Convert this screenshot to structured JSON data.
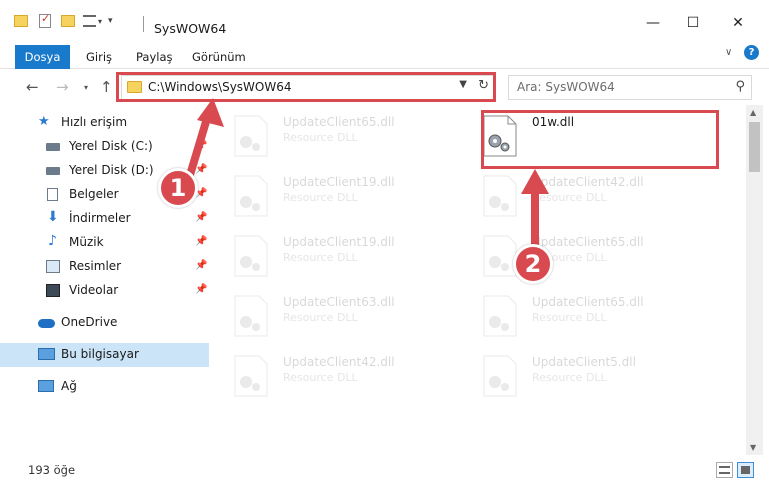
{
  "window": {
    "title": "SysWOW64",
    "controls": {
      "minimize": "—",
      "maximize": "☐",
      "close": "✕"
    }
  },
  "ribbon": {
    "tabs": [
      "Dosya",
      "Giriş",
      "Paylaş",
      "Görünüm"
    ],
    "help_icon": "?",
    "collapse_icon": "∨"
  },
  "address": {
    "path": "C:\\Windows\\SysWOW64",
    "search_placeholder": "Ara: SysWOW64"
  },
  "sidebar": {
    "items": [
      {
        "label": "Hızlı erişim",
        "icon": "star-icon",
        "pinned": false
      },
      {
        "label": "Yerel Disk (C:)",
        "icon": "drive-icon",
        "pinned": true
      },
      {
        "label": "Yerel Disk (D:)",
        "icon": "drive-icon",
        "pinned": true
      },
      {
        "label": "Belgeler",
        "icon": "documents-icon",
        "pinned": true
      },
      {
        "label": "İndirmeler",
        "icon": "downloads-icon",
        "pinned": true
      },
      {
        "label": "Müzik",
        "icon": "music-icon",
        "pinned": true
      },
      {
        "label": "Resimler",
        "icon": "pictures-icon",
        "pinned": true
      },
      {
        "label": "Videolar",
        "icon": "videos-icon",
        "pinned": true
      },
      {
        "label": "OneDrive",
        "icon": "cloud-icon",
        "pinned": false
      },
      {
        "label": "Bu bilgisayar",
        "icon": "computer-icon",
        "pinned": false
      },
      {
        "label": "Ağ",
        "icon": "network-icon",
        "pinned": false
      }
    ]
  },
  "files": {
    "left": [
      {
        "name": "UpdateClient65.dll",
        "type": "Resource DLL"
      },
      {
        "name": "UpdateClient19.dll",
        "type": "Resource DLL"
      },
      {
        "name": "UpdateClient19.dll",
        "type": "Resource DLL"
      },
      {
        "name": "UpdateClient63.dll",
        "type": "Resource DLL"
      },
      {
        "name": "UpdateClient42.dll",
        "type": "Resource DLL"
      }
    ],
    "right": [
      {
        "name": "01w.dll",
        "type": ""
      },
      {
        "name": "UpdateClient42.dll",
        "type": "Resource DLL"
      },
      {
        "name": "UpdateClient65.dll",
        "type": "Resource DLL"
      },
      {
        "name": "UpdateClient65.dll",
        "type": "Resource DLL"
      },
      {
        "name": "UpdateClient5.dll",
        "type": "Resource DLL"
      }
    ]
  },
  "status": {
    "count": "193 öğe"
  },
  "annotations": {
    "badge1": "1",
    "badge2": "2",
    "color": "#d84a4f"
  },
  "colors": {
    "accent": "#1979ca",
    "selected": "#cce4f7",
    "highlight": "#d84a4f"
  }
}
